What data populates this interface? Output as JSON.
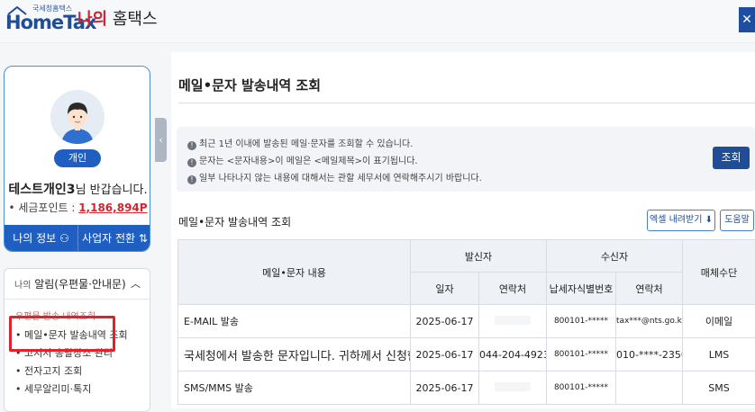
{
  "header": {
    "logo_sub": "국세청홈택스",
    "logo_main": "HomeTax",
    "site_title_accent": "나의",
    "site_title_rest": " 홈택스",
    "close_icon": "close-icon"
  },
  "profile": {
    "badge": "개인",
    "name": "테스트개인3",
    "greeting_suffix": "님 반갑습니다.",
    "points_label": "• 세금포인트 : ",
    "points_value": "1,186,894P",
    "my_info_label": "나의 정보",
    "my_info_icon": "person-icon",
    "switch_label": "사업자 전환",
    "switch_icon": "swap-icon"
  },
  "notice": {
    "head_small": "나의",
    "head": " 알림(우편물·안내문)",
    "items": [
      "우편물 발송 내역조회",
      "• 메일•문자 발송내역 조회",
      "• 고지서 송달장소 관리",
      "• 전자고지 조회",
      "• 세무알리미·톡지"
    ]
  },
  "main": {
    "page_title": "메일•문자 발송내역 조회",
    "info_lines": [
      "최근 1년 이내에 발송된 메일·문자를 조회할 수 있습니다.",
      "문자는 <문자내용>이 메일은 <메일제목>이 표기됩니다.",
      "일부 나타나지 않는 내용에 대해서는 관할 세무서에 연락해주시기 바랍니다."
    ],
    "lookup_button": "조회",
    "section_title": "메일•문자 발송내역 조회",
    "excel_button": "엑셀 내려받기",
    "help_button": "도움말"
  },
  "table": {
    "h_content": "메일•문자 내용",
    "h_sender": "발신자",
    "h_receiver": "수신자",
    "h_medium": "매체수단",
    "h_date": "일자",
    "h_contact": "연락처",
    "h_taxid": "납세자식별번호",
    "h_rcontact": "연락처",
    "rows": [
      {
        "content": "E-MAIL 발송",
        "date": "2025-06-17",
        "contact": "",
        "taxid": "800101-*****",
        "rcontact": "tax***@nts.go.kr",
        "medium": "이메일"
      },
      {
        "content": "국세청에서 발송한 문자입니다. 귀하께서 신청한 사업",
        "date": "2025-06-17",
        "contact": "044-204-4923",
        "taxid": "800101-*****",
        "rcontact": "010-****-2350",
        "medium": "LMS"
      },
      {
        "content": "SMS/MMS 발송",
        "date": "2025-06-17",
        "contact": "",
        "taxid": "800101-*****",
        "rcontact": "",
        "medium": "SMS"
      }
    ]
  }
}
